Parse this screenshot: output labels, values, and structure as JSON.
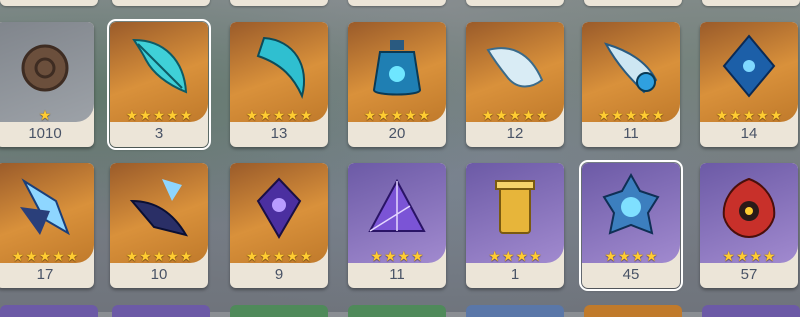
{
  "rows": [
    {
      "items": [
        {
          "name": "brown-coin-icon",
          "count": "1010",
          "rarity": 1
        },
        {
          "name": "teal-feather-icon",
          "count": "3",
          "rarity": 5,
          "selected": true
        },
        {
          "name": "teal-fang-icon",
          "count": "13",
          "rarity": 5
        },
        {
          "name": "blue-potion-flask-icon",
          "count": "20",
          "rarity": 5
        },
        {
          "name": "white-horn-icon",
          "count": "12",
          "rarity": 5
        },
        {
          "name": "blue-goggles-icon",
          "count": "11",
          "rarity": 5
        },
        {
          "name": "blue-crystal-drop-icon",
          "count": "14",
          "rarity": 5
        }
      ]
    },
    {
      "items": [
        {
          "name": "ice-crystal-claw-icon",
          "count": "17",
          "rarity": 5
        },
        {
          "name": "dark-crystal-wing-icon",
          "count": "10",
          "rarity": 5
        },
        {
          "name": "violet-gem-pendant-icon",
          "count": "9",
          "rarity": 5
        },
        {
          "name": "violet-triangle-prism-icon",
          "count": "11",
          "rarity": 4
        },
        {
          "name": "golden-tower-icon",
          "count": "1",
          "rarity": 4
        },
        {
          "name": "blue-crystal-orb-icon",
          "count": "45",
          "rarity": 4,
          "selected": true
        },
        {
          "name": "red-flame-mask-icon",
          "count": "57",
          "rarity": 4
        }
      ]
    }
  ],
  "star_glyph": "★",
  "colors": {
    "card_base": "#ece5d8",
    "rarity_5": "#c07a2b",
    "rarity_4": "#8a77c2",
    "rarity_1": "#8f949a",
    "star": "#ffcc32",
    "count_text": "#495366"
  }
}
